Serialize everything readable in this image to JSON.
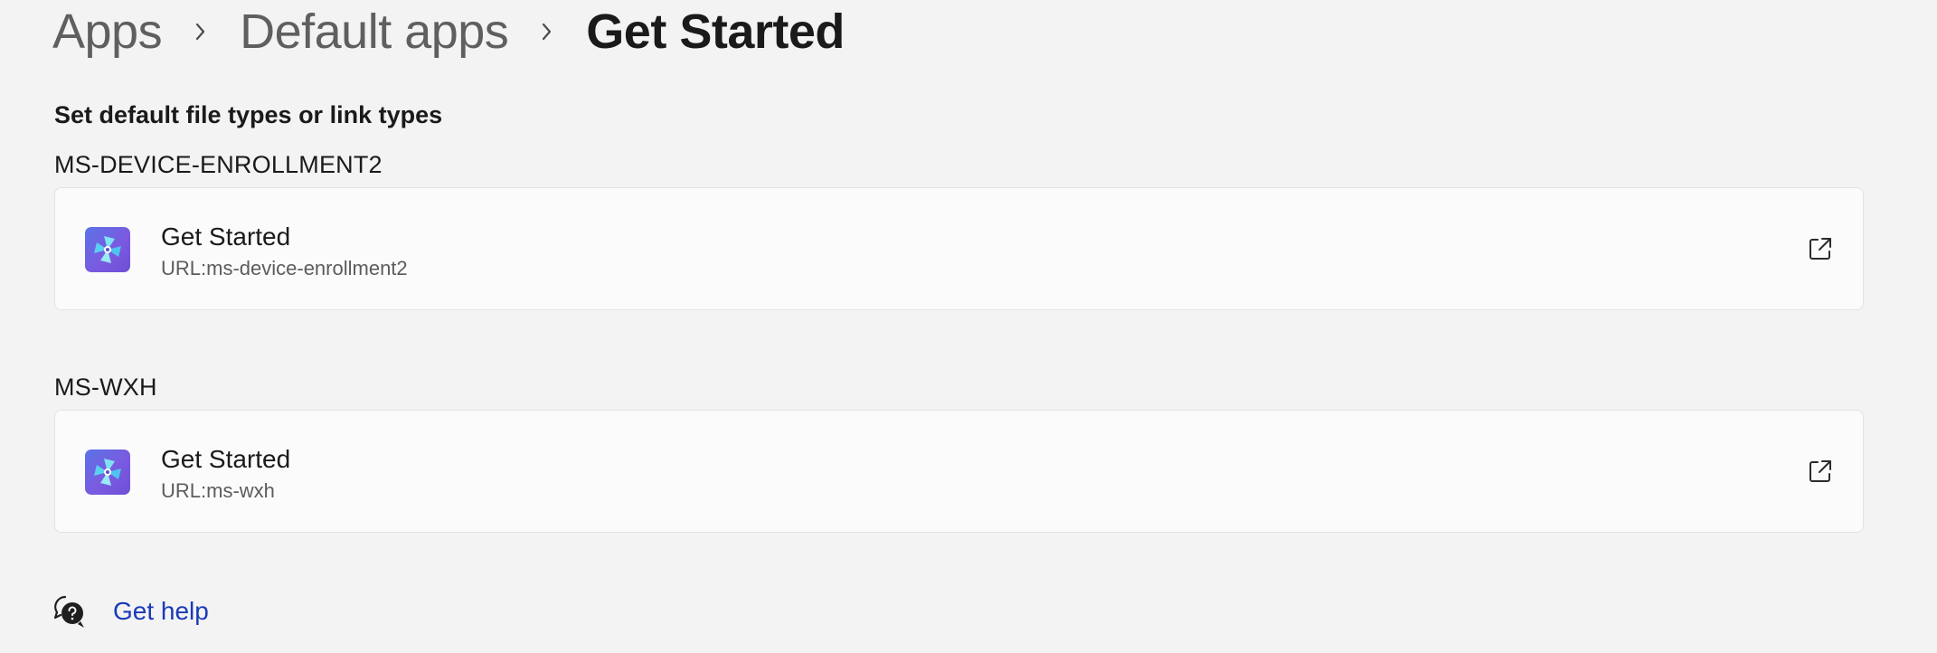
{
  "breadcrumb": {
    "items": [
      "Apps",
      "Default apps"
    ],
    "current": "Get Started"
  },
  "section_heading": "Set default file types or link types",
  "associations": [
    {
      "group_label": "MS-DEVICE-ENROLLMENT2",
      "app_name": "Get Started",
      "protocol": "URL:ms-device-enrollment2",
      "icon": "get-started-app-icon"
    },
    {
      "group_label": "MS-WXH",
      "app_name": "Get Started",
      "protocol": "URL:ms-wxh",
      "icon": "get-started-app-icon"
    }
  ],
  "help": {
    "label": "Get help",
    "icon": "help-chat-icon"
  },
  "colors": {
    "background": "#f3f3f3",
    "card": "#fbfbfb",
    "link": "#1a3ab8",
    "app_icon_accent": "#6a5be0"
  }
}
